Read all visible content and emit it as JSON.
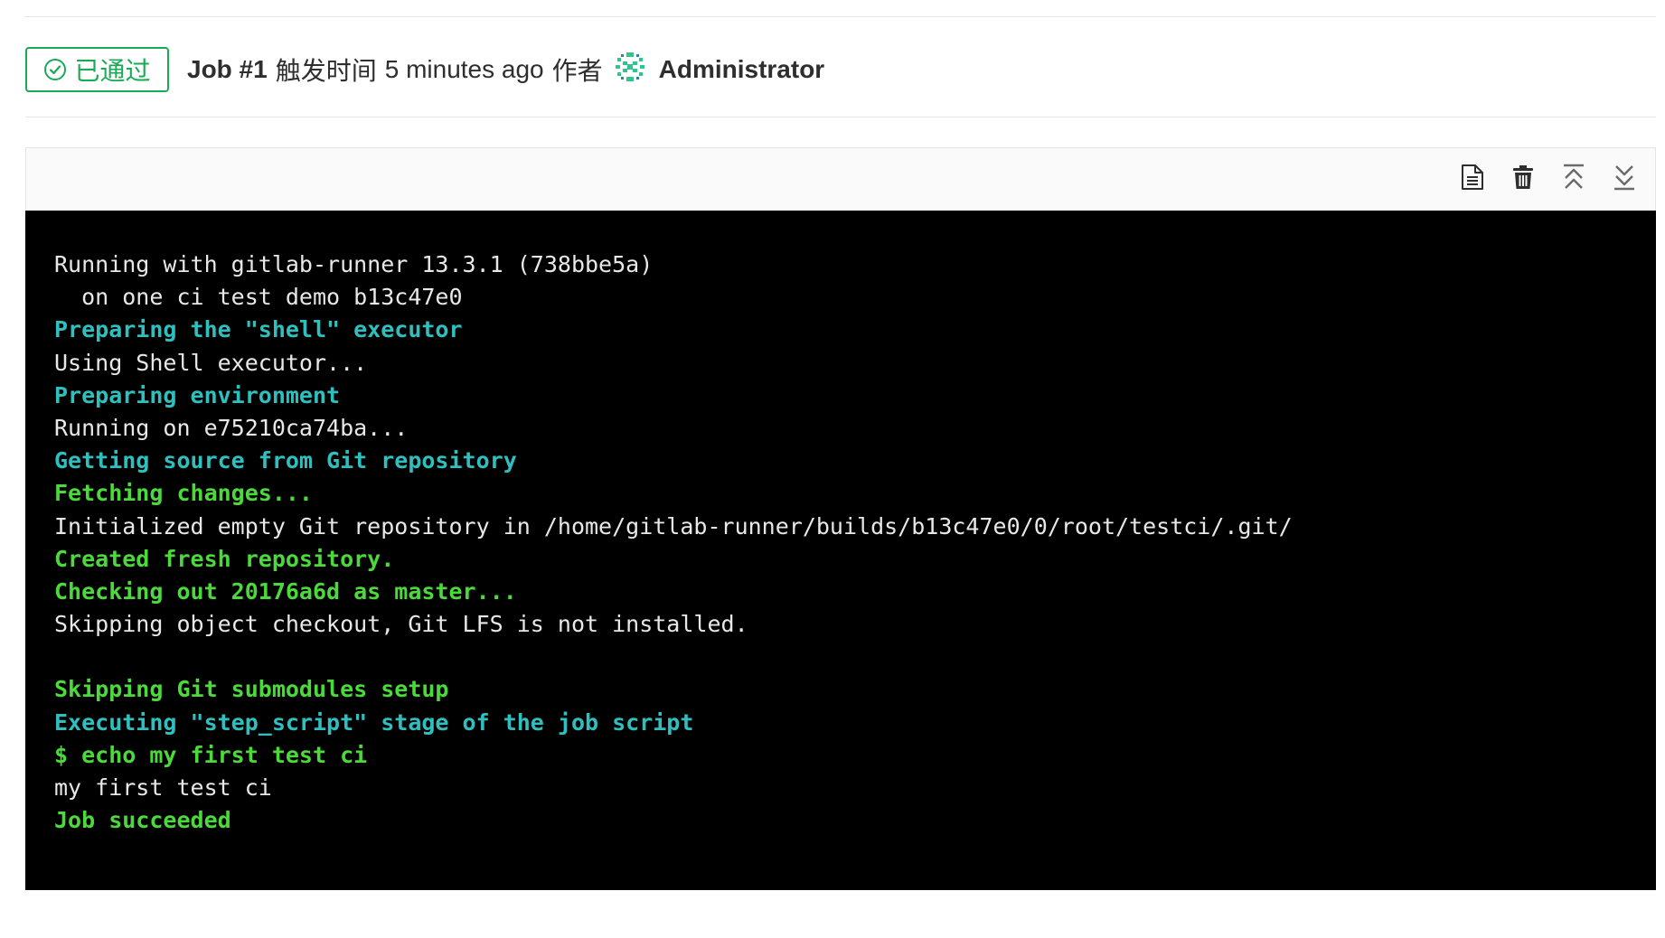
{
  "job": {
    "status_label": "已通过",
    "status_color": "#1aaa55",
    "id_label": "Job #1",
    "triggered_label": "触发时间",
    "time_ago": "5 minutes ago",
    "by_label": "作者",
    "author": "Administrator",
    "status_icon": "check-circle-icon",
    "avatar_icon": "identicon-avatar"
  },
  "toolbar": {
    "buttons": [
      {
        "name": "show-raw-button",
        "icon": "document-icon"
      },
      {
        "name": "erase-log-button",
        "icon": "trash-icon"
      },
      {
        "name": "scroll-to-top-button",
        "icon": "scroll-top-icon"
      },
      {
        "name": "scroll-to-bottom-button",
        "icon": "scroll-bottom-icon"
      }
    ]
  },
  "log": {
    "colors": {
      "plain": "#e8e8e8",
      "section": "#2fbfbf",
      "success": "#4cd93c",
      "background": "#000000"
    },
    "lines": [
      {
        "text": "Running with gitlab-runner 13.3.1 (738bbe5a)",
        "style": "plain"
      },
      {
        "text": "  on one ci test demo b13c47e0",
        "style": "plain"
      },
      {
        "text": "Preparing the \"shell\" executor",
        "style": "section"
      },
      {
        "text": "Using Shell executor...",
        "style": "plain"
      },
      {
        "text": "Preparing environment",
        "style": "section"
      },
      {
        "text": "Running on e75210ca74ba...",
        "style": "plain"
      },
      {
        "text": "Getting source from Git repository",
        "style": "section"
      },
      {
        "text": "Fetching changes...",
        "style": "success"
      },
      {
        "text": "Initialized empty Git repository in /home/gitlab-runner/builds/b13c47e0/0/root/testci/.git/",
        "style": "plain"
      },
      {
        "text": "Created fresh repository.",
        "style": "success"
      },
      {
        "text": "Checking out 20176a6d as master...",
        "style": "success"
      },
      {
        "text": "Skipping object checkout, Git LFS is not installed.",
        "style": "plain"
      },
      {
        "text": "",
        "style": "plain"
      },
      {
        "text": "Skipping Git submodules setup",
        "style": "success"
      },
      {
        "text": "Executing \"step_script\" stage of the job script",
        "style": "section"
      },
      {
        "text": "$ echo my first test ci",
        "style": "success"
      },
      {
        "text": "my first test ci",
        "style": "plain"
      },
      {
        "text": "Job succeeded",
        "style": "success"
      }
    ]
  }
}
